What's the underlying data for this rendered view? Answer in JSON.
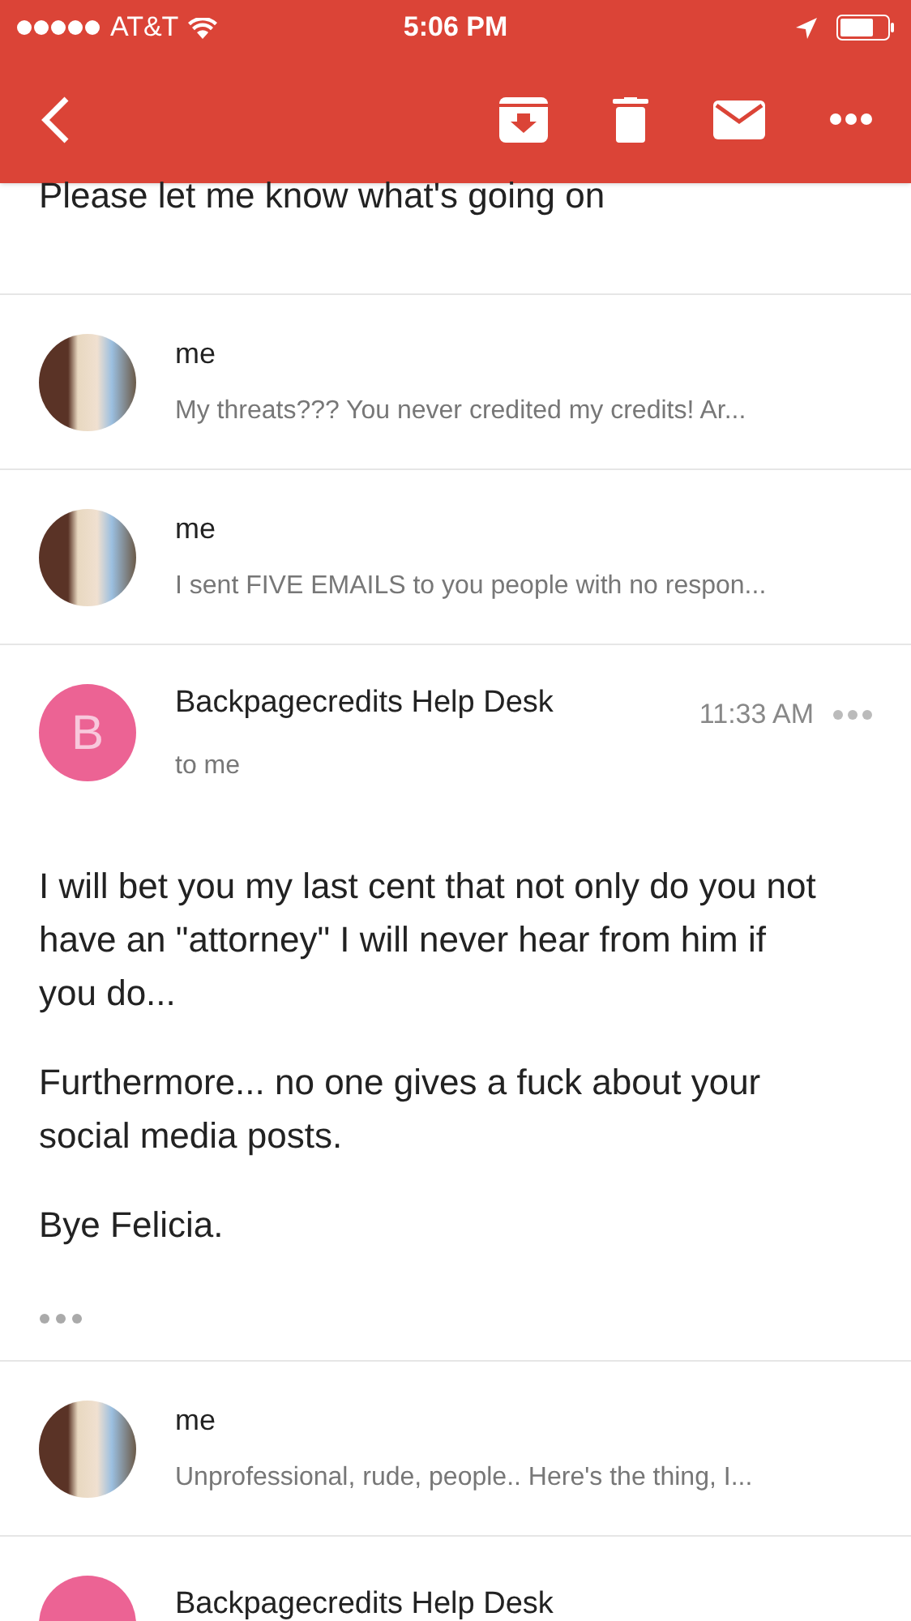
{
  "status_bar": {
    "carrier": "AT&T",
    "time": "5:06 PM"
  },
  "top_text": "Please let me know what's going on",
  "messages": [
    {
      "kind": "collapsed",
      "sender": "me",
      "avatar": {
        "kind": "photo"
      },
      "snippet": "My threats??? You never credited my credits! Ar..."
    },
    {
      "kind": "collapsed",
      "sender": "me",
      "avatar": {
        "kind": "photo"
      },
      "snippet": "I sent FIVE EMAILS to you people with no respon..."
    },
    {
      "kind": "expanded",
      "sender": "Backpagecredits Help Desk",
      "avatar": {
        "kind": "letter",
        "letter": "B",
        "color": "#ec6394"
      },
      "recipient": "to me",
      "time": "11:33 AM",
      "body": [
        "I will bet you my last cent that not only do you not have an \"attorney\" I will never hear from him if you do...",
        "Furthermore... no one gives a fuck about your social media posts.",
        "Bye Felicia."
      ]
    },
    {
      "kind": "collapsed",
      "sender": "me",
      "avatar": {
        "kind": "photo"
      },
      "snippet": "Unprofessional, rude, people.. Here's the thing, I..."
    },
    {
      "kind": "partial",
      "sender": "Backpagecredits Help Desk",
      "avatar": {
        "kind": "letter",
        "color": "#ec6394"
      }
    }
  ]
}
